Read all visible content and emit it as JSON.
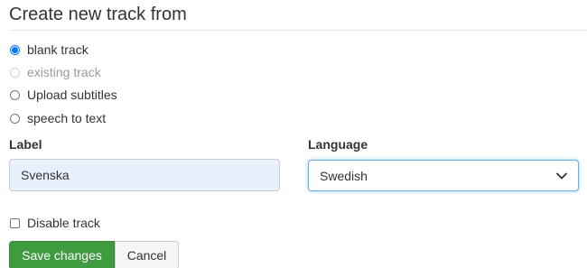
{
  "heading": "Create new track from",
  "source_options": [
    {
      "label": "blank track",
      "checked": true,
      "disabled": false
    },
    {
      "label": "existing track",
      "checked": false,
      "disabled": true
    },
    {
      "label": "Upload subtitles",
      "checked": false,
      "disabled": false
    },
    {
      "label": "speech to text",
      "checked": false,
      "disabled": false
    }
  ],
  "label_field": {
    "title": "Label",
    "value": "Svenska"
  },
  "language_field": {
    "title": "Language",
    "selected": "Swedish"
  },
  "disable_track": {
    "label": "Disable track",
    "checked": false
  },
  "buttons": {
    "save": "Save changes",
    "cancel": "Cancel"
  },
  "colors": {
    "primary_radio": "#0075ff",
    "save_button": "#3e9b3e",
    "input_autofill_bg": "#e8f0fe",
    "select_focus_border": "#66afe9"
  },
  "icons": {
    "select_arrow": "chevron-down-icon"
  }
}
